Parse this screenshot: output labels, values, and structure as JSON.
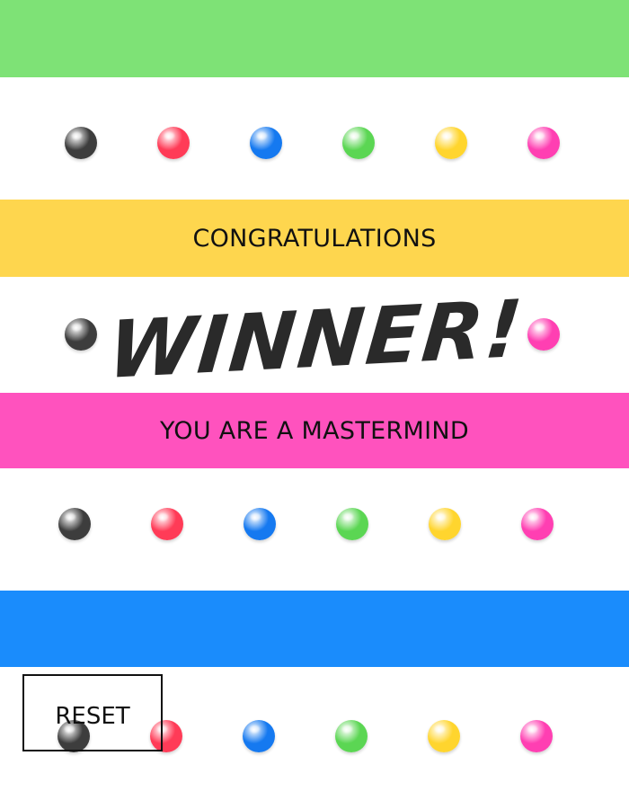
{
  "colors": {
    "green": "#7ee276",
    "yellow": "#fed64e",
    "pink": "#ff52be",
    "blue": "#1a8cfc",
    "peg_black": "#3d3d3d",
    "peg_red": "#ff3b57",
    "peg_blue": "#1579f0",
    "peg_green": "#5bd653",
    "peg_yellow": "#ffd52e",
    "peg_pink": "#ff3fb2"
  },
  "banner": {
    "congratulations": "CONGRATULATIONS",
    "winner": "WINNER!",
    "mastermind": "YOU ARE A MASTERMIND"
  },
  "peg_rows": [
    [
      "black",
      "red",
      "blue",
      "green",
      "yellow",
      "pink"
    ],
    [
      "black",
      "pink"
    ],
    [
      "black",
      "red",
      "blue",
      "green",
      "yellow",
      "pink"
    ],
    [
      "black",
      "red",
      "blue",
      "green",
      "yellow",
      "pink"
    ]
  ],
  "controls": {
    "reset_label": "RESET"
  }
}
